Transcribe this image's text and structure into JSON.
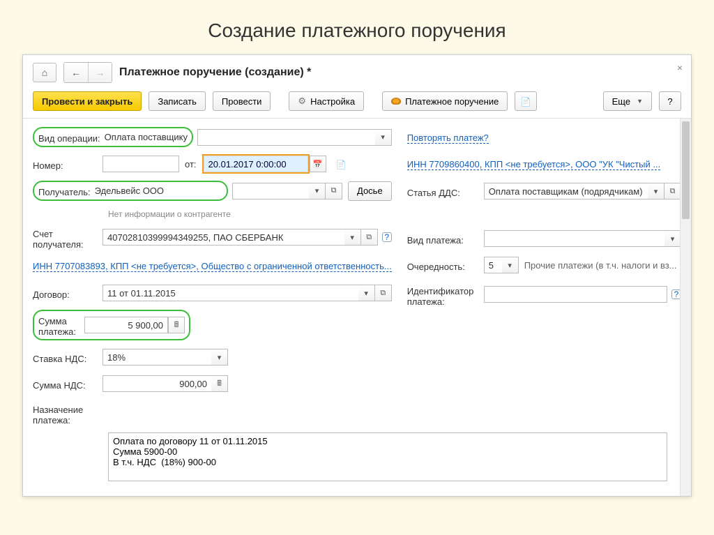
{
  "slide_title": "Создание платежного поручения",
  "window": {
    "title": "Платежное поручение (создание) *"
  },
  "toolbar": {
    "post_close": "Провести и закрыть",
    "save": "Записать",
    "post": "Провести",
    "settings": "Настройка",
    "payment_order": "Платежное поручение",
    "more": "Еще",
    "help": "?"
  },
  "left": {
    "operation_label": "Вид операции:",
    "operation_value": "Оплата поставщику",
    "number_label": "Номер:",
    "number_value": "",
    "from_label": "от:",
    "date_value": "20.01.2017  0:00:00",
    "recipient_label": "Получатель:",
    "recipient_value": "Эдельвейс ООО",
    "dossier_btn": "Досье",
    "no_info": "Нет информации о контрагенте",
    "recipient_account_label": "Счет получателя:",
    "recipient_account_value": "40702810399994349255, ПАО СБЕРБАНК",
    "payer_link": "ИНН 7707083893, КПП <не требуется>, Общество с ограниченной ответственность...",
    "contract_label": "Договор:",
    "contract_value": "11 от 01.11.2015",
    "amount_label": "Сумма платежа:",
    "amount_value": "5 900,00",
    "vat_rate_label": "Ставка НДС:",
    "vat_rate_value": "18%",
    "vat_sum_label": "Сумма НДС:",
    "vat_sum_value": "900,00",
    "purpose_label": "Назначение платежа:",
    "purpose_value": "Оплата по договору 11 от 01.11.2015\nСумма 5900-00\nВ т.ч. НДС  (18%) 900-00"
  },
  "right": {
    "repeat_link": "Повторять платеж?",
    "inn_link": "ИНН 7709860400, КПП <не требуется>, ООО \"УК \"Чистый ...",
    "dds_label": "Статья ДДС:",
    "dds_value": "Оплата поставщикам (подрядчикам)",
    "payment_type_label": "Вид платежа:",
    "payment_type_value": "",
    "priority_label": "Очередность:",
    "priority_value": "5",
    "priority_desc": "Прочие платежи (в т.ч. налоги и вз...",
    "identifier_label": "Идентификатор платежа:",
    "identifier_value": ""
  }
}
